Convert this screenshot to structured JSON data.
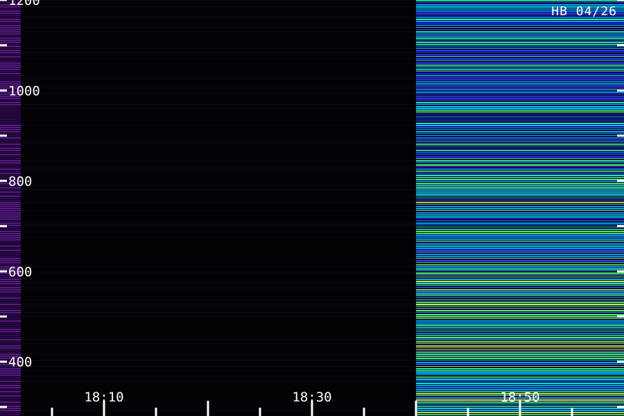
{
  "chart_data": {
    "type": "heatmap",
    "title": "",
    "stamp": "HB 04/26",
    "xlabel": "",
    "ylabel": "",
    "grid": false,
    "colormap": [
      "#000000",
      "#3a0a6a",
      "#2a2aff",
      "#00c8ff",
      "#40ff90",
      "#ffd040"
    ],
    "x_ticks": {
      "labeled": [
        "18:10",
        "18:30",
        "18:50"
      ],
      "start_time": "18:00",
      "minor_every_min": 5
    },
    "y_ticks": {
      "labeled": [
        400,
        600,
        800,
        1000,
        1200
      ],
      "range": [
        280,
        1200
      ],
      "minor_every": 100
    },
    "time_range": [
      "18:00",
      "18:60"
    ],
    "segments": [
      {
        "from": "18:00",
        "to": "18:02",
        "intensity": 0.25
      },
      {
        "from": "18:02",
        "to": "18:40",
        "intensity": 0.02
      },
      {
        "from": "18:40",
        "to": "19:00",
        "intensity": 0.85
      }
    ]
  }
}
